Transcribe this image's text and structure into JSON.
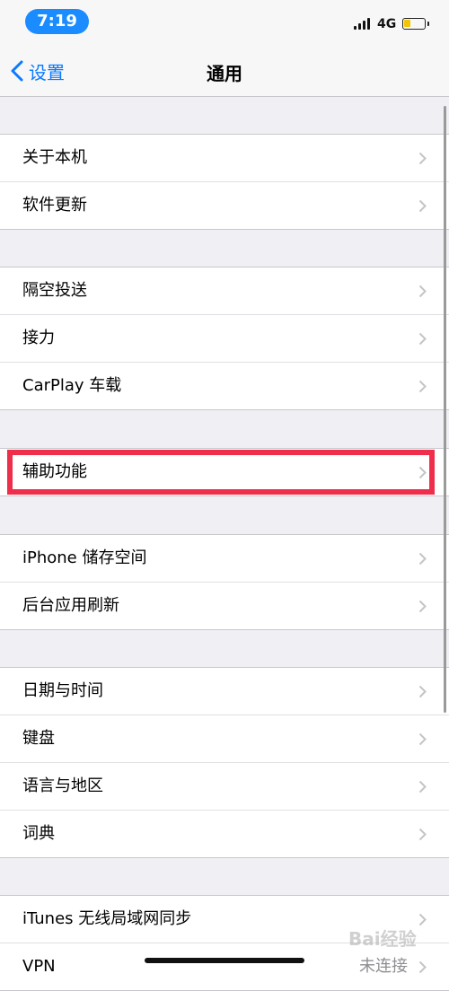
{
  "status_bar": {
    "time": "7:19",
    "network": "4G"
  },
  "nav": {
    "back_label": "设置",
    "title": "通用"
  },
  "groups": [
    {
      "items": [
        {
          "label": "关于本机"
        },
        {
          "label": "软件更新"
        }
      ]
    },
    {
      "items": [
        {
          "label": "隔空投送"
        },
        {
          "label": "接力"
        },
        {
          "label": "CarPlay 车载"
        }
      ]
    },
    {
      "items": [
        {
          "label": "辅助功能"
        }
      ]
    },
    {
      "items": [
        {
          "label": "iPhone 储存空间"
        },
        {
          "label": "后台应用刷新"
        }
      ]
    },
    {
      "items": [
        {
          "label": "日期与时间"
        },
        {
          "label": "键盘"
        },
        {
          "label": "语言与地区"
        },
        {
          "label": "词典"
        }
      ]
    },
    {
      "items": [
        {
          "label": "iTunes 无线局域网同步"
        },
        {
          "label": "VPN",
          "value": "未连接"
        }
      ]
    }
  ],
  "colors": {
    "accent": "#0a7aff",
    "highlight": "#ee2e4a",
    "background": "#efeff4",
    "battery": "#f5c400"
  },
  "watermark": "Bai经验"
}
